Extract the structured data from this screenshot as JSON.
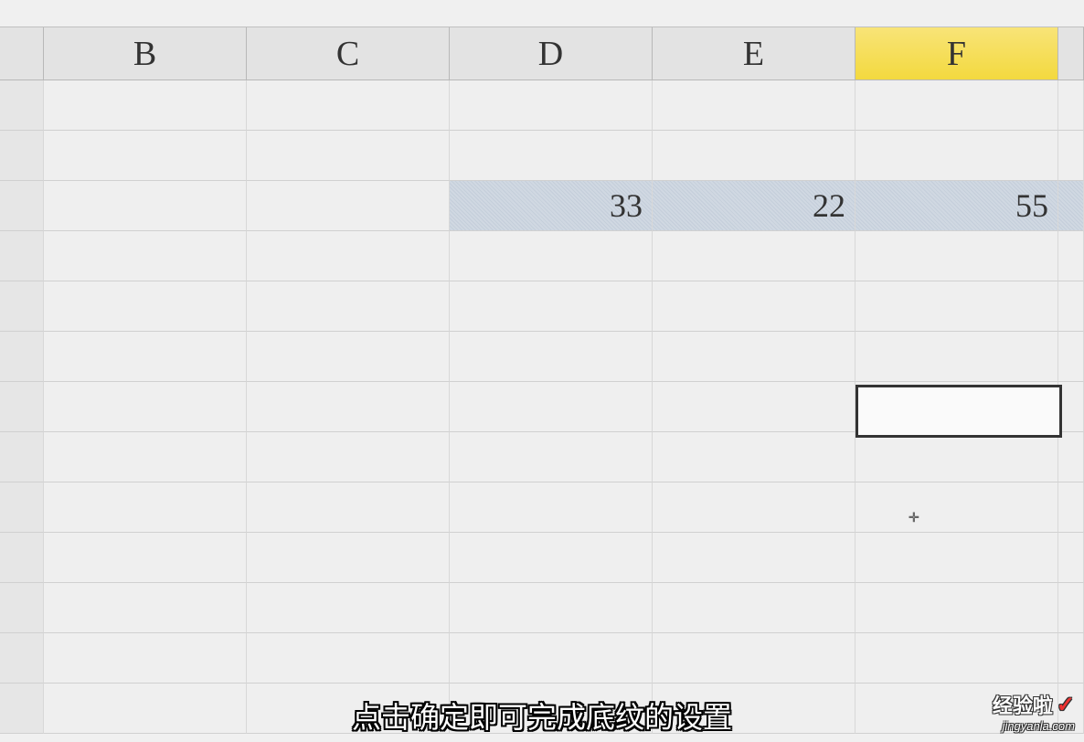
{
  "columns": {
    "b": "B",
    "c": "C",
    "d": "D",
    "e": "E",
    "f": "F"
  },
  "cells": {
    "d3": "33",
    "e3": "22",
    "f3": "55"
  },
  "caption": "点击确定即可完成底纹的设置",
  "watermark": {
    "title": "经验啦",
    "check": "✓",
    "url": "jingyanla.com"
  },
  "cursor": "✛"
}
